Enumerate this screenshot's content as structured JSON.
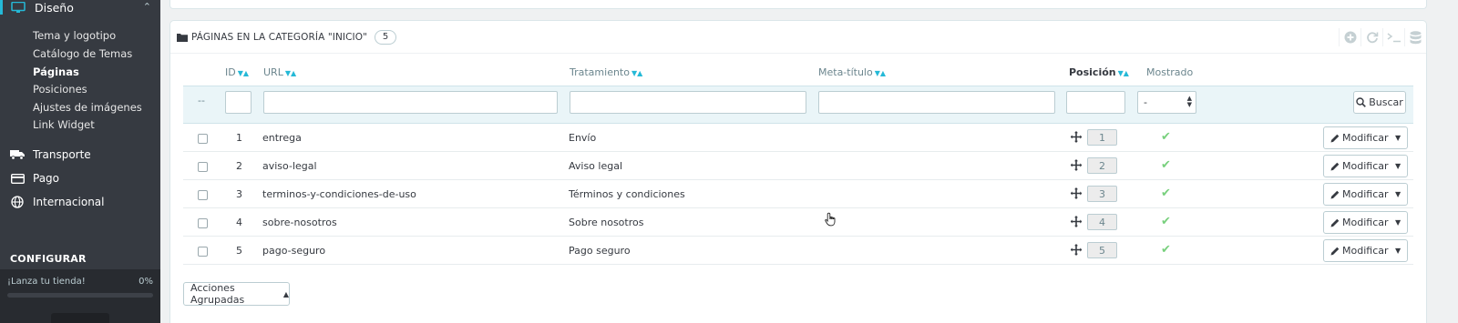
{
  "sidebar": {
    "active_section": "Diseño",
    "sub_items": [
      "Tema y logotipo",
      "Catálogo de Temas",
      "Páginas",
      "Posiciones",
      "Ajustes de imágenes",
      "Link Widget"
    ],
    "current_sub": "Páginas",
    "main_items": [
      {
        "label": "Transporte",
        "icon": "truck-icon"
      },
      {
        "label": "Pago",
        "icon": "credit-card-icon"
      },
      {
        "label": "Internacional",
        "icon": "globe-icon"
      }
    ],
    "section_heading": "CONFIGURAR",
    "launch": {
      "label": "¡Lanza tu tienda!",
      "percent_text": "0%",
      "progress": 0
    }
  },
  "panel": {
    "title": "PÁGINAS EN LA CATEGORÍA \"INICIO\"",
    "count": "5",
    "tools": [
      "add-icon",
      "refresh-icon",
      "sql-icon",
      "database-icon"
    ]
  },
  "table": {
    "headers": {
      "id": "ID",
      "url": "URL",
      "treatment": "Tratamiento",
      "meta_title": "Meta-título",
      "position": "Posición",
      "shown": "Mostrado"
    },
    "filter": {
      "id_dash": "--",
      "shown_select": "-",
      "search_label": "Buscar"
    },
    "rows": [
      {
        "id": "1",
        "url": "entrega",
        "treatment": "Envío",
        "position": "1"
      },
      {
        "id": "2",
        "url": "aviso-legal",
        "treatment": "Aviso legal",
        "position": "2"
      },
      {
        "id": "3",
        "url": "terminos-y-condiciones-de-uso",
        "treatment": "Términos y condiciones",
        "position": "3"
      },
      {
        "id": "4",
        "url": "sobre-nosotros",
        "treatment": "Sobre nosotros",
        "position": "4"
      },
      {
        "id": "5",
        "url": "pago-seguro",
        "treatment": "Pago seguro",
        "position": "5"
      }
    ],
    "edit_label": "Modificar",
    "bulk_label": "Acciones Agrupadas"
  },
  "colors": {
    "accent": "#25b9d7",
    "sidebar_bg": "#363a41",
    "success": "#78d07d"
  }
}
